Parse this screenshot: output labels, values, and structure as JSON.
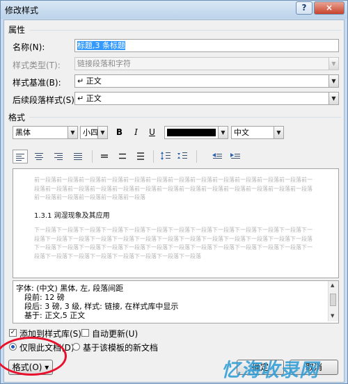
{
  "window": {
    "title": "修改样式",
    "help_icon": "?",
    "close_icon": "×"
  },
  "properties": {
    "section_label": "属性",
    "name_label": "名称(N):",
    "name_value": "标题,3 条标题",
    "style_type_label": "样式类型(T):",
    "style_type_value": "链接段落和字符",
    "based_on_label": "样式基准(B):",
    "based_on_value": "↵ 正文",
    "following_label": "后续段落样式(S):",
    "following_value": "↵ 正文"
  },
  "format": {
    "section_label": "格式",
    "font_value": "黑体",
    "size_value": "小四",
    "bold_label": "B",
    "italic_label": "I",
    "underline_label": "U",
    "font_color": "#000000",
    "language_value": "中文"
  },
  "preview": {
    "before_text": "前一段落前一段落前一段落前一段落前一段落前一段落前一段落前一段落前一段落前一段落前一段落前一段落前一段落前一段落前一段落前一段落前一段落前一段落前一段落前一段落前一段落前一段落前一段落前一段落前一段落前一段落前一段落前一段落前一段落前一段落",
    "heading_text": "1.3.1  润湿现象及其应用",
    "after_text": "下一段落下一段落下一段落下一段落下一段落下一段落下一段落下一段落下一段落下一段落下一段落下一段落下一段落下一段落下一段落下一段落下一段落下一段落下一段落下一段落下一段落下一段落下一段落下一段落下一段落下一段落下一段落下一段落下一段落下一段落下一段落下一段落下一段落下一段落下一段落下一段落下一段落下一段落下一段落下一段落下一段落下一段落下一段落下一段落下一段落"
  },
  "description": {
    "lines": [
      "字体: (中文) 黑体, 左, 段落间距",
      "段前: 12 磅",
      "段后: 3 磅, 3 级, 样式: 链接, 在样式库中显示",
      "基于: 正文,5 正文"
    ]
  },
  "options": {
    "add_to_gallery_label": "添加到样式库(S)",
    "add_to_gallery_checked": true,
    "auto_update_label": "自动更新(U)",
    "auto_update_checked": false,
    "this_doc_only_label": "仅限此文档(D)",
    "new_docs_label": "基于该模板的新文档",
    "this_doc_only_selected": true
  },
  "buttons": {
    "format_label": "格式(O) ▾",
    "ok_label": "确定",
    "cancel_label": "取消"
  },
  "watermark": {
    "text": "忆海收录网"
  },
  "colors": {
    "accent": "#3399ff",
    "annotation_circle": "#e8112d",
    "titlebar": "#c9dcef"
  }
}
